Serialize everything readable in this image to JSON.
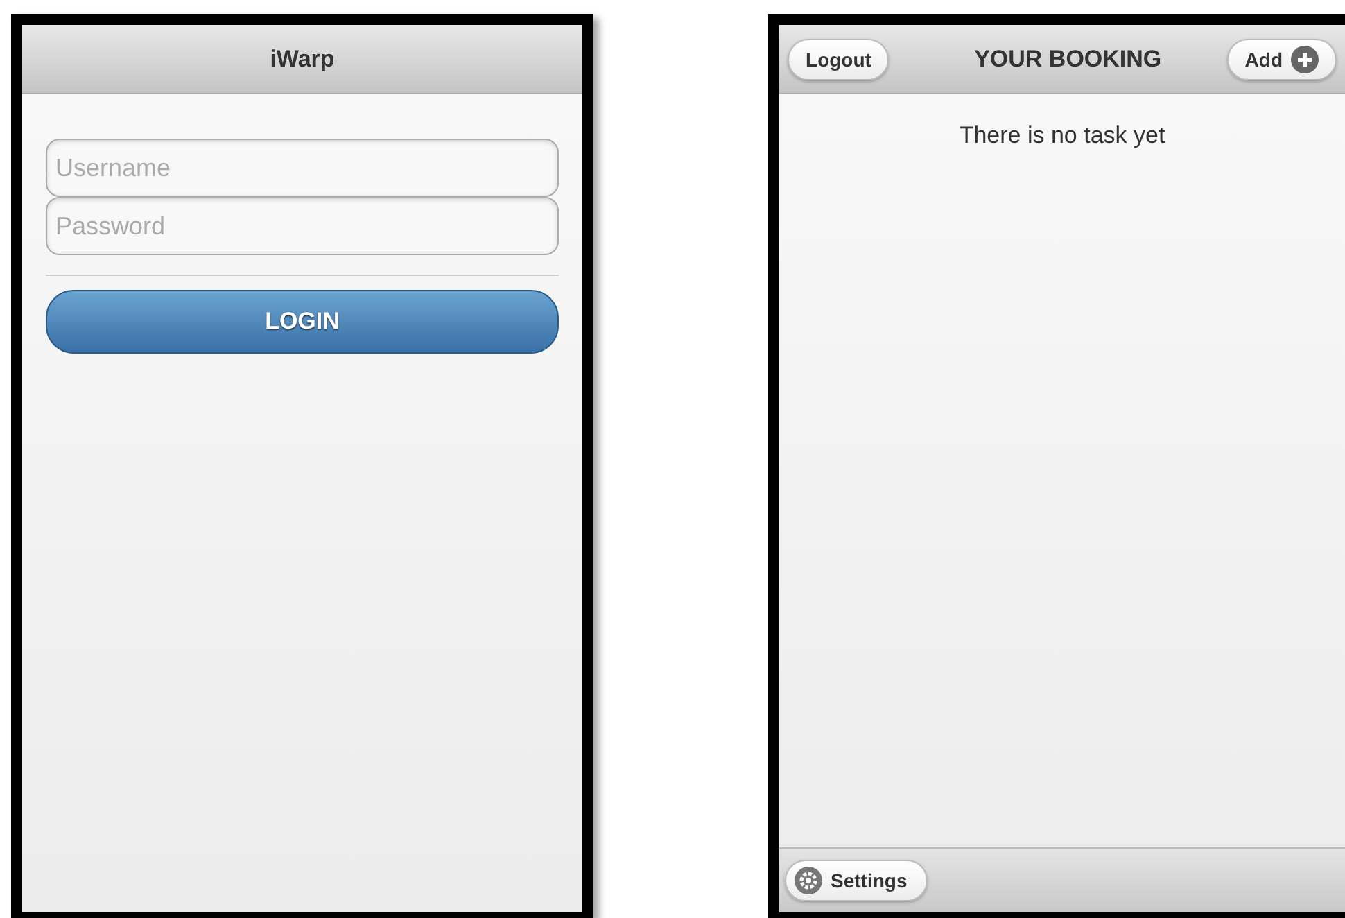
{
  "login_screen": {
    "header": {
      "title": "iWarp"
    },
    "fields": [
      {
        "placeholder": "Username"
      },
      {
        "placeholder": "Password"
      }
    ],
    "button": {
      "label": "LOGIN"
    }
  },
  "booking_screen": {
    "header": {
      "title": "YOUR BOOKING",
      "left_button": "Logout",
      "right_button": "Add"
    },
    "message": "There is no task yet",
    "footer": {
      "button": "Settings"
    }
  }
}
